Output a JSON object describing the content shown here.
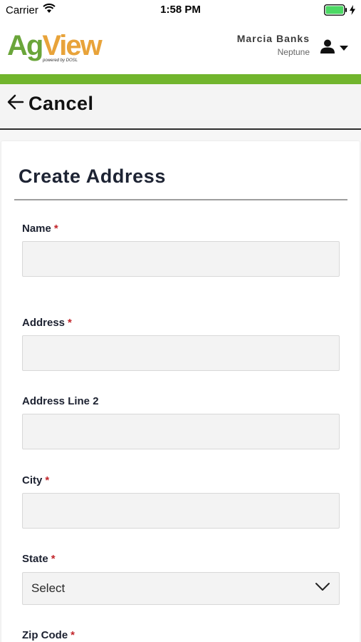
{
  "status_bar": {
    "carrier": "Carrier",
    "time": "1:58 PM"
  },
  "header": {
    "logo_ag": "Ag",
    "logo_view": "View",
    "logo_tagline": "powered by DOSL",
    "user_name": "Marcia Banks",
    "user_org": "Neptune"
  },
  "colors": {
    "brand_green": "#71b52d",
    "logo_orange": "#e8a33a",
    "required": "#c2252b"
  },
  "nav": {
    "cancel_label": "Cancel",
    "back_icon": "arrow-left-icon"
  },
  "form": {
    "title": "Create Address",
    "required_mark": "*",
    "fields": {
      "name": {
        "label": "Name",
        "value": ""
      },
      "address": {
        "label": "Address",
        "value": ""
      },
      "address2": {
        "label": "Address Line 2",
        "value": ""
      },
      "city": {
        "label": "City",
        "value": ""
      },
      "state": {
        "label": "State",
        "selected": "Select"
      },
      "zip": {
        "label": "Zip Code"
      }
    }
  }
}
